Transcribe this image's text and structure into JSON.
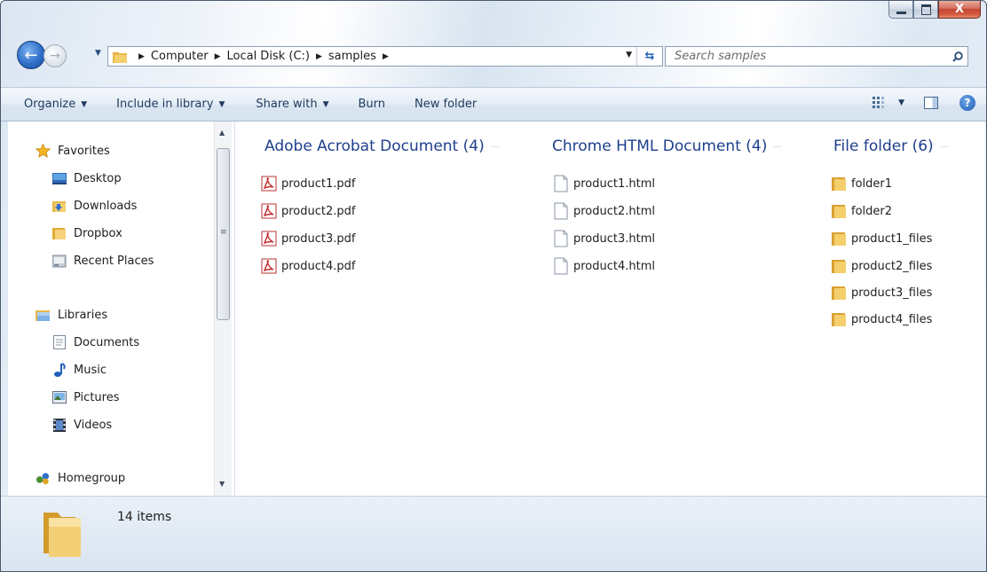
{
  "window": {
    "caption_minimize": "minimize",
    "caption_maximize": "maximize",
    "caption_close": "X"
  },
  "address": {
    "crumbs": [
      "Computer",
      "Local Disk (C:)",
      "samples"
    ]
  },
  "search": {
    "placeholder": "Search samples"
  },
  "toolbar": {
    "organize": "Organize",
    "include_in_library": "Include in library",
    "share_with": "Share with",
    "burn": "Burn",
    "new_folder": "New folder",
    "help": "?"
  },
  "nav": {
    "favorites": {
      "label": "Favorites",
      "items": [
        "Desktop",
        "Downloads",
        "Dropbox",
        "Recent Places"
      ]
    },
    "libraries": {
      "label": "Libraries",
      "items": [
        "Documents",
        "Music",
        "Pictures",
        "Videos"
      ]
    },
    "homegroup": {
      "label": "Homegroup"
    }
  },
  "groups": [
    {
      "title": "Adobe Acrobat Document (4)",
      "icon": "pdf-icon",
      "files": [
        "product1.pdf",
        "product2.pdf",
        "product3.pdf",
        "product4.pdf"
      ]
    },
    {
      "title": "Chrome HTML Document (4)",
      "icon": "html-file-icon",
      "files": [
        "product1.html",
        "product2.html",
        "product3.html",
        "product4.html"
      ]
    },
    {
      "title": "File folder (6)",
      "icon": "folder-icon",
      "files": [
        "folder1",
        "folder2",
        "product1_files",
        "product2_files",
        "product3_files",
        "product4_files"
      ]
    }
  ],
  "status": {
    "count": "14 items"
  },
  "colors": {
    "group_title": "#1e3f8c",
    "command_text": "#1e3a5e",
    "folder": "#e8b84a",
    "pdf": "#c0282d"
  }
}
